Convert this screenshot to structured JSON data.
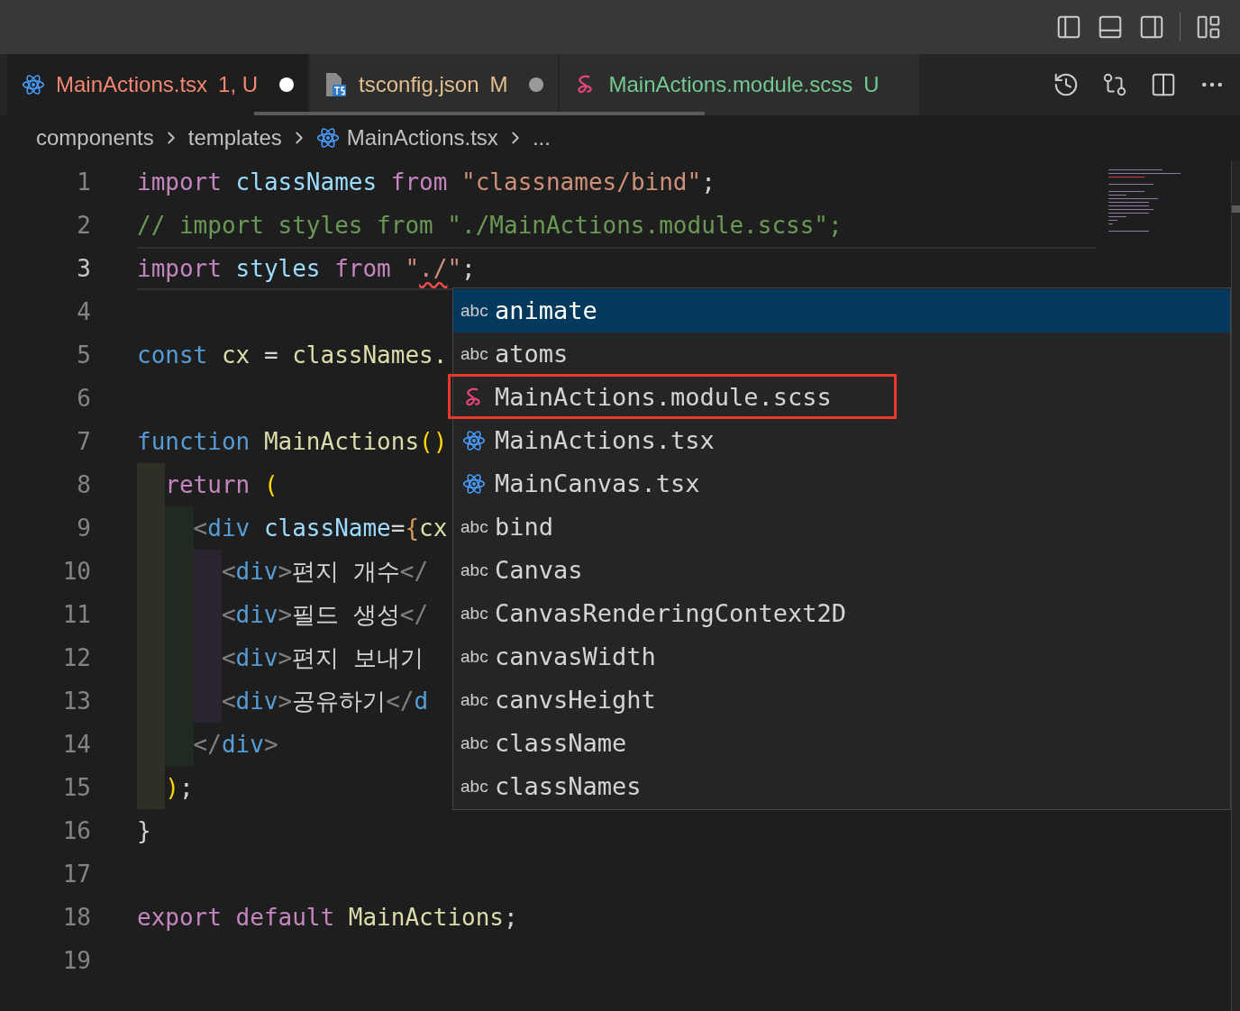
{
  "tabs": [
    {
      "label": "MainActions.tsx",
      "status": "1, U",
      "kind": "tsx",
      "color": "#f48771",
      "dirty": true,
      "selected": true
    },
    {
      "label": "tsconfig.json",
      "status": "M",
      "kind": "json",
      "color": "#e2c08d",
      "dirty": true,
      "selected": false
    },
    {
      "label": "MainActions.module.scss",
      "status": "U",
      "kind": "scss",
      "color": "#73c991",
      "dirty": false,
      "selected": false
    }
  ],
  "breadcrumb": [
    {
      "label": "components",
      "kind": "folder"
    },
    {
      "label": "templates",
      "kind": "folder"
    },
    {
      "label": "MainActions.tsx",
      "kind": "tsx"
    },
    {
      "label": "...",
      "kind": "symbol"
    }
  ],
  "lines": [
    {
      "number": "1",
      "selected": false,
      "tokens": [
        {
          "text": "import ",
          "kind": "keyword"
        },
        {
          "text": "classNames ",
          "kind": "variable"
        },
        {
          "text": "from ",
          "kind": "keyword"
        },
        {
          "text": "\"classnames/bind\"",
          "kind": "string"
        },
        {
          "text": ";",
          "kind": "plain"
        }
      ]
    },
    {
      "number": "2",
      "selected": false,
      "tokens": [
        {
          "text": "// import styles from \"./MainActions.module.scss\";",
          "kind": "comment"
        }
      ]
    },
    {
      "number": "3",
      "selected": true,
      "tokens": [
        {
          "text": "import ",
          "kind": "keyword",
          "error": false
        },
        {
          "text": "styles ",
          "kind": "variable",
          "error": false
        },
        {
          "text": "from ",
          "kind": "keyword",
          "error": false
        },
        {
          "text": "\"",
          "kind": "string",
          "error": false
        },
        {
          "text": "./",
          "kind": "string",
          "error": true
        },
        {
          "text": "\"",
          "kind": "string",
          "error": false
        },
        {
          "text": ";",
          "kind": "plain",
          "error": false
        }
      ]
    },
    {
      "number": "4",
      "selected": false
    },
    {
      "number": "5",
      "selected": false,
      "tokens": [
        {
          "text": "const ",
          "kind": "storage"
        },
        {
          "text": "cx ",
          "kind": "function"
        },
        {
          "text": "= ",
          "kind": "plain"
        },
        {
          "text": "classNames.",
          "kind": "function"
        }
      ]
    },
    {
      "number": "6",
      "selected": false
    },
    {
      "number": "7",
      "selected": false,
      "tokens": [
        {
          "text": "function ",
          "kind": "storage"
        },
        {
          "text": "MainActions",
          "kind": "function"
        },
        {
          "text": "()",
          "kind": "bracket"
        }
      ]
    },
    {
      "number": "8",
      "selected": false,
      "tokens": [
        {
          "text": "  return ",
          "kind": "keyword"
        },
        {
          "text": "(",
          "kind": "bracket"
        }
      ]
    },
    {
      "number": "9",
      "selected": false,
      "tokens": [
        {
          "text": "    <",
          "kind": "punct"
        },
        {
          "text": "div ",
          "kind": "tag"
        },
        {
          "text": "className",
          "kind": "variable"
        },
        {
          "text": "=",
          "kind": "plain"
        },
        {
          "text": "{",
          "kind": "brace"
        },
        {
          "text": "cx",
          "kind": "function"
        }
      ]
    },
    {
      "number": "10",
      "selected": false,
      "tokens": [
        {
          "text": "      <",
          "kind": "punct"
        },
        {
          "text": "div",
          "kind": "tag"
        },
        {
          "text": ">",
          "kind": "punct"
        },
        {
          "text": "편지 개수",
          "kind": "plain"
        },
        {
          "text": "</",
          "kind": "punct"
        }
      ]
    },
    {
      "number": "11",
      "selected": false,
      "tokens": [
        {
          "text": "      <",
          "kind": "punct"
        },
        {
          "text": "div",
          "kind": "tag"
        },
        {
          "text": ">",
          "kind": "punct"
        },
        {
          "text": "필드 생성",
          "kind": "plain"
        },
        {
          "text": "</",
          "kind": "punct"
        }
      ]
    },
    {
      "number": "12",
      "selected": false,
      "tokens": [
        {
          "text": "      <",
          "kind": "punct"
        },
        {
          "text": "div",
          "kind": "tag"
        },
        {
          "text": ">",
          "kind": "punct"
        },
        {
          "text": "편지 보내기",
          "kind": "plain"
        }
      ]
    },
    {
      "number": "13",
      "selected": false,
      "tokens": [
        {
          "text": "      <",
          "kind": "punct"
        },
        {
          "text": "div",
          "kind": "tag"
        },
        {
          "text": ">",
          "kind": "punct"
        },
        {
          "text": "공유하기",
          "kind": "plain"
        },
        {
          "text": "</",
          "kind": "punct"
        },
        {
          "text": "d",
          "kind": "tag"
        }
      ]
    },
    {
      "number": "14",
      "selected": false,
      "tokens": [
        {
          "text": "    </",
          "kind": "punct"
        },
        {
          "text": "div",
          "kind": "tag"
        },
        {
          "text": ">",
          "kind": "punct"
        }
      ]
    },
    {
      "number": "15",
      "selected": false,
      "tokens": [
        {
          "text": "  )",
          "kind": "bracket"
        },
        {
          "text": ";",
          "kind": "plain"
        }
      ]
    },
    {
      "number": "16",
      "selected": false,
      "tokens": [
        {
          "text": "}",
          "kind": "plain"
        }
      ]
    },
    {
      "number": "17",
      "selected": false
    },
    {
      "number": "18",
      "selected": false,
      "tokens": [
        {
          "text": "export ",
          "kind": "keyword"
        },
        {
          "text": "default ",
          "kind": "keyword"
        },
        {
          "text": "MainActions",
          "kind": "function"
        },
        {
          "text": ";",
          "kind": "plain"
        }
      ]
    },
    {
      "number": "19",
      "selected": false
    }
  ],
  "suggestions": [
    {
      "label": "animate",
      "kind": "text",
      "tag": "abc",
      "selected": true,
      "highlighted": false
    },
    {
      "label": "atoms",
      "kind": "text",
      "tag": "abc",
      "selected": false,
      "highlighted": false
    },
    {
      "label": "MainActions.module.scss",
      "kind": "scss",
      "selected": false,
      "highlighted": true
    },
    {
      "label": "MainActions.tsx",
      "kind": "tsx",
      "selected": false,
      "highlighted": false
    },
    {
      "label": "MainCanvas.tsx",
      "kind": "tsx",
      "selected": false,
      "highlighted": false
    },
    {
      "label": "bind",
      "kind": "text",
      "tag": "abc",
      "selected": false,
      "highlighted": false
    },
    {
      "label": "Canvas",
      "kind": "text",
      "tag": "abc",
      "selected": false,
      "highlighted": false
    },
    {
      "label": "CanvasRenderingContext2D",
      "kind": "text",
      "tag": "abc",
      "selected": false,
      "highlighted": false
    },
    {
      "label": "canvasWidth",
      "kind": "text",
      "tag": "abc",
      "selected": false,
      "highlighted": false
    },
    {
      "label": "canvsHeight",
      "kind": "text",
      "tag": "abc",
      "selected": false,
      "highlighted": false
    },
    {
      "label": "className",
      "kind": "text",
      "tag": "abc",
      "selected": false,
      "highlighted": false
    },
    {
      "label": "classNames",
      "kind": "text",
      "tag": "abc",
      "selected": false,
      "highlighted": false
    }
  ]
}
